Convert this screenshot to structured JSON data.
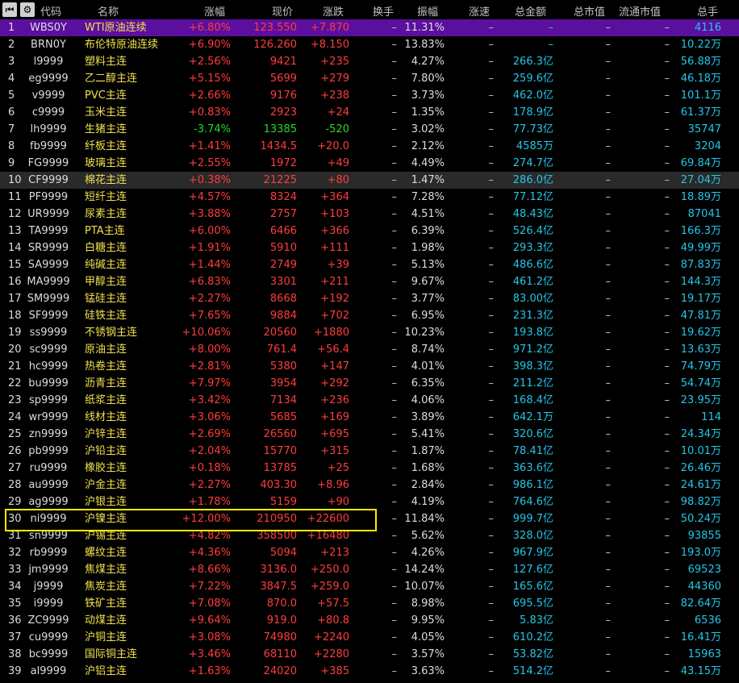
{
  "header": {
    "columns": [
      "代码",
      "名称",
      "涨幅",
      "现价",
      "涨跌",
      "换手",
      "振幅",
      "涨速",
      "总金额",
      "总市值",
      "流通市值",
      "总手"
    ],
    "icons": [
      "skip-back-icon",
      "gear-icon"
    ]
  },
  "rows": [
    {
      "idx": "1",
      "code": "WBS0Y",
      "name": "WTI原油连续",
      "chg_pct": "+6.80%",
      "price": "123.550",
      "chg": "+7.870",
      "turnover": "–",
      "amp": "11.31%",
      "speed": "–",
      "amount": "–",
      "mktcap": "–",
      "float": "–",
      "volume": "4116"
    },
    {
      "idx": "2",
      "code": "BRN0Y",
      "name": "布伦特原油连续",
      "chg_pct": "+6.90%",
      "price": "126.260",
      "chg": "+8.150",
      "turnover": "–",
      "amp": "13.83%",
      "speed": "–",
      "amount": "–",
      "mktcap": "–",
      "float": "–",
      "volume": "10.22万"
    },
    {
      "idx": "3",
      "code": "l9999",
      "name": "塑料主连",
      "chg_pct": "+2.56%",
      "price": "9421",
      "chg": "+235",
      "turnover": "–",
      "amp": "4.27%",
      "speed": "–",
      "amount": "266.3亿",
      "mktcap": "–",
      "float": "–",
      "volume": "56.88万"
    },
    {
      "idx": "4",
      "code": "eg9999",
      "name": "乙二醇主连",
      "chg_pct": "+5.15%",
      "price": "5699",
      "chg": "+279",
      "turnover": "–",
      "amp": "7.80%",
      "speed": "–",
      "amount": "259.6亿",
      "mktcap": "–",
      "float": "–",
      "volume": "46.18万"
    },
    {
      "idx": "5",
      "code": "v9999",
      "name": "PVC主连",
      "chg_pct": "+2.66%",
      "price": "9176",
      "chg": "+238",
      "turnover": "–",
      "amp": "3.73%",
      "speed": "–",
      "amount": "462.0亿",
      "mktcap": "–",
      "float": "–",
      "volume": "101.1万"
    },
    {
      "idx": "6",
      "code": "c9999",
      "name": "玉米主连",
      "chg_pct": "+0.83%",
      "price": "2923",
      "chg": "+24",
      "turnover": "–",
      "amp": "1.35%",
      "speed": "–",
      "amount": "178.9亿",
      "mktcap": "–",
      "float": "–",
      "volume": "61.37万"
    },
    {
      "idx": "7",
      "code": "lh9999",
      "name": "生猪主连",
      "chg_pct": "-3.74%",
      "price": "13385",
      "chg": "-520",
      "turnover": "–",
      "amp": "3.02%",
      "speed": "–",
      "amount": "77.73亿",
      "mktcap": "–",
      "float": "–",
      "volume": "35747"
    },
    {
      "idx": "8",
      "code": "fb9999",
      "name": "纤板主连",
      "chg_pct": "+1.41%",
      "price": "1434.5",
      "chg": "+20.0",
      "turnover": "–",
      "amp": "2.12%",
      "speed": "–",
      "amount": "4585万",
      "mktcap": "–",
      "float": "–",
      "volume": "3204"
    },
    {
      "idx": "9",
      "code": "FG9999",
      "name": "玻璃主连",
      "chg_pct": "+2.55%",
      "price": "1972",
      "chg": "+49",
      "turnover": "–",
      "amp": "4.49%",
      "speed": "–",
      "amount": "274.7亿",
      "mktcap": "–",
      "float": "–",
      "volume": "69.84万"
    },
    {
      "idx": "10",
      "code": "CF9999",
      "name": "棉花主连",
      "chg_pct": "+0.38%",
      "price": "21225",
      "chg": "+80",
      "turnover": "–",
      "amp": "1.47%",
      "speed": "–",
      "amount": "286.0亿",
      "mktcap": "–",
      "float": "–",
      "volume": "27.04万"
    },
    {
      "idx": "11",
      "code": "PF9999",
      "name": "短纤主连",
      "chg_pct": "+4.57%",
      "price": "8324",
      "chg": "+364",
      "turnover": "–",
      "amp": "7.28%",
      "speed": "–",
      "amount": "77.12亿",
      "mktcap": "–",
      "float": "–",
      "volume": "18.89万"
    },
    {
      "idx": "12",
      "code": "UR9999",
      "name": "尿素主连",
      "chg_pct": "+3.88%",
      "price": "2757",
      "chg": "+103",
      "turnover": "–",
      "amp": "4.51%",
      "speed": "–",
      "amount": "48.43亿",
      "mktcap": "–",
      "float": "–",
      "volume": "87041"
    },
    {
      "idx": "13",
      "code": "TA9999",
      "name": "PTA主连",
      "chg_pct": "+6.00%",
      "price": "6466",
      "chg": "+366",
      "turnover": "–",
      "amp": "6.39%",
      "speed": "–",
      "amount": "526.4亿",
      "mktcap": "–",
      "float": "–",
      "volume": "166.3万"
    },
    {
      "idx": "14",
      "code": "SR9999",
      "name": "白糖主连",
      "chg_pct": "+1.91%",
      "price": "5910",
      "chg": "+111",
      "turnover": "–",
      "amp": "1.98%",
      "speed": "–",
      "amount": "293.3亿",
      "mktcap": "–",
      "float": "–",
      "volume": "49.99万"
    },
    {
      "idx": "15",
      "code": "SA9999",
      "name": "纯碱主连",
      "chg_pct": "+1.44%",
      "price": "2749",
      "chg": "+39",
      "turnover": "–",
      "amp": "5.13%",
      "speed": "–",
      "amount": "486.6亿",
      "mktcap": "–",
      "float": "–",
      "volume": "87.83万"
    },
    {
      "idx": "16",
      "code": "MA9999",
      "name": "甲醇主连",
      "chg_pct": "+6.83%",
      "price": "3301",
      "chg": "+211",
      "turnover": "–",
      "amp": "9.67%",
      "speed": "–",
      "amount": "461.2亿",
      "mktcap": "–",
      "float": "–",
      "volume": "144.3万"
    },
    {
      "idx": "17",
      "code": "SM9999",
      "name": "锰硅主连",
      "chg_pct": "+2.27%",
      "price": "8668",
      "chg": "+192",
      "turnover": "–",
      "amp": "3.77%",
      "speed": "–",
      "amount": "83.00亿",
      "mktcap": "–",
      "float": "–",
      "volume": "19.17万"
    },
    {
      "idx": "18",
      "code": "SF9999",
      "name": "硅铁主连",
      "chg_pct": "+7.65%",
      "price": "9884",
      "chg": "+702",
      "turnover": "–",
      "amp": "6.95%",
      "speed": "–",
      "amount": "231.3亿",
      "mktcap": "–",
      "float": "–",
      "volume": "47.81万"
    },
    {
      "idx": "19",
      "code": "ss9999",
      "name": "不锈钢主连",
      "chg_pct": "+10.06%",
      "price": "20560",
      "chg": "+1880",
      "turnover": "–",
      "amp": "10.23%",
      "speed": "–",
      "amount": "193.8亿",
      "mktcap": "–",
      "float": "–",
      "volume": "19.62万"
    },
    {
      "idx": "20",
      "code": "sc9999",
      "name": "原油主连",
      "chg_pct": "+8.00%",
      "price": "761.4",
      "chg": "+56.4",
      "turnover": "–",
      "amp": "8.74%",
      "speed": "–",
      "amount": "971.2亿",
      "mktcap": "–",
      "float": "–",
      "volume": "13.63万"
    },
    {
      "idx": "21",
      "code": "hc9999",
      "name": "热卷主连",
      "chg_pct": "+2.81%",
      "price": "5380",
      "chg": "+147",
      "turnover": "–",
      "amp": "4.01%",
      "speed": "–",
      "amount": "398.3亿",
      "mktcap": "–",
      "float": "–",
      "volume": "74.79万"
    },
    {
      "idx": "22",
      "code": "bu9999",
      "name": "沥青主连",
      "chg_pct": "+7.97%",
      "price": "3954",
      "chg": "+292",
      "turnover": "–",
      "amp": "6.35%",
      "speed": "–",
      "amount": "211.2亿",
      "mktcap": "–",
      "float": "–",
      "volume": "54.74万"
    },
    {
      "idx": "23",
      "code": "sp9999",
      "name": "纸浆主连",
      "chg_pct": "+3.42%",
      "price": "7134",
      "chg": "+236",
      "turnover": "–",
      "amp": "4.06%",
      "speed": "–",
      "amount": "168.4亿",
      "mktcap": "–",
      "float": "–",
      "volume": "23.95万"
    },
    {
      "idx": "24",
      "code": "wr9999",
      "name": "线材主连",
      "chg_pct": "+3.06%",
      "price": "5685",
      "chg": "+169",
      "turnover": "–",
      "amp": "3.89%",
      "speed": "–",
      "amount": "642.1万",
      "mktcap": "–",
      "float": "–",
      "volume": "114"
    },
    {
      "idx": "25",
      "code": "zn9999",
      "name": "沪锌主连",
      "chg_pct": "+2.69%",
      "price": "26560",
      "chg": "+695",
      "turnover": "–",
      "amp": "5.41%",
      "speed": "–",
      "amount": "320.6亿",
      "mktcap": "–",
      "float": "–",
      "volume": "24.34万"
    },
    {
      "idx": "26",
      "code": "pb9999",
      "name": "沪铅主连",
      "chg_pct": "+2.04%",
      "price": "15770",
      "chg": "+315",
      "turnover": "–",
      "amp": "1.87%",
      "speed": "–",
      "amount": "78.41亿",
      "mktcap": "–",
      "float": "–",
      "volume": "10.01万"
    },
    {
      "idx": "27",
      "code": "ru9999",
      "name": "橡胶主连",
      "chg_pct": "+0.18%",
      "price": "13785",
      "chg": "+25",
      "turnover": "–",
      "amp": "1.68%",
      "speed": "–",
      "amount": "363.6亿",
      "mktcap": "–",
      "float": "–",
      "volume": "26.46万"
    },
    {
      "idx": "28",
      "code": "au9999",
      "name": "沪金主连",
      "chg_pct": "+2.27%",
      "price": "403.30",
      "chg": "+8.96",
      "turnover": "–",
      "amp": "2.84%",
      "speed": "–",
      "amount": "986.1亿",
      "mktcap": "–",
      "float": "–",
      "volume": "24.61万"
    },
    {
      "idx": "29",
      "code": "ag9999",
      "name": "沪银主连",
      "chg_pct": "+1.78%",
      "price": "5159",
      "chg": "+90",
      "turnover": "–",
      "amp": "4.19%",
      "speed": "–",
      "amount": "764.6亿",
      "mktcap": "–",
      "float": "–",
      "volume": "98.82万"
    },
    {
      "idx": "30",
      "code": "ni9999",
      "name": "沪镍主连",
      "chg_pct": "+12.00%",
      "price": "210950",
      "chg": "+22600",
      "turnover": "–",
      "amp": "11.84%",
      "speed": "–",
      "amount": "999.7亿",
      "mktcap": "–",
      "float": "–",
      "volume": "50.24万"
    },
    {
      "idx": "31",
      "code": "sn9999",
      "name": "沪锡主连",
      "chg_pct": "+4.82%",
      "price": "358500",
      "chg": "+16480",
      "turnover": "–",
      "amp": "5.62%",
      "speed": "–",
      "amount": "328.0亿",
      "mktcap": "–",
      "float": "–",
      "volume": "93855"
    },
    {
      "idx": "32",
      "code": "rb9999",
      "name": "螺纹主连",
      "chg_pct": "+4.36%",
      "price": "5094",
      "chg": "+213",
      "turnover": "–",
      "amp": "4.26%",
      "speed": "–",
      "amount": "967.9亿",
      "mktcap": "–",
      "float": "–",
      "volume": "193.0万"
    },
    {
      "idx": "33",
      "code": "jm9999",
      "name": "焦煤主连",
      "chg_pct": "+8.66%",
      "price": "3136.0",
      "chg": "+250.0",
      "turnover": "–",
      "amp": "14.24%",
      "speed": "–",
      "amount": "127.6亿",
      "mktcap": "–",
      "float": "–",
      "volume": "69523"
    },
    {
      "idx": "34",
      "code": "j9999",
      "name": "焦炭主连",
      "chg_pct": "+7.22%",
      "price": "3847.5",
      "chg": "+259.0",
      "turnover": "–",
      "amp": "10.07%",
      "speed": "–",
      "amount": "165.6亿",
      "mktcap": "–",
      "float": "–",
      "volume": "44360"
    },
    {
      "idx": "35",
      "code": "i9999",
      "name": "铁矿主连",
      "chg_pct": "+7.08%",
      "price": "870.0",
      "chg": "+57.5",
      "turnover": "–",
      "amp": "8.98%",
      "speed": "–",
      "amount": "695.5亿",
      "mktcap": "–",
      "float": "–",
      "volume": "82.64万"
    },
    {
      "idx": "36",
      "code": "ZC9999",
      "name": "动煤主连",
      "chg_pct": "+9.64%",
      "price": "919.0",
      "chg": "+80.8",
      "turnover": "–",
      "amp": "9.95%",
      "speed": "–",
      "amount": "5.83亿",
      "mktcap": "–",
      "float": "–",
      "volume": "6536"
    },
    {
      "idx": "37",
      "code": "cu9999",
      "name": "沪铜主连",
      "chg_pct": "+3.08%",
      "price": "74980",
      "chg": "+2240",
      "turnover": "–",
      "amp": "4.05%",
      "speed": "–",
      "amount": "610.2亿",
      "mktcap": "–",
      "float": "–",
      "volume": "16.41万"
    },
    {
      "idx": "38",
      "code": "bc9999",
      "name": "国际铜主连",
      "chg_pct": "+3.46%",
      "price": "68110",
      "chg": "+2280",
      "turnover": "–",
      "amp": "3.57%",
      "speed": "–",
      "amount": "53.82亿",
      "mktcap": "–",
      "float": "–",
      "volume": "15963"
    },
    {
      "idx": "39",
      "code": "al9999",
      "name": "沪铝主连",
      "chg_pct": "+1.63%",
      "price": "24020",
      "chg": "+385",
      "turnover": "–",
      "amp": "3.63%",
      "speed": "–",
      "amount": "514.2亿",
      "mktcap": "–",
      "float": "–",
      "volume": "43.15万"
    }
  ],
  "colors": {
    "selected_row": "#5b0f9e",
    "highlight_box": "#ffea00",
    "up": "#ff3d3d",
    "down": "#28d828",
    "amount": "#22c7e8",
    "code": "#dcdcdc",
    "name": "#f0e050"
  }
}
